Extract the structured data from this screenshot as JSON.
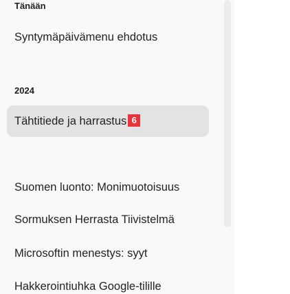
{
  "sidebar": {
    "sections": [
      {
        "heading": "Tänään",
        "items": [
          {
            "label": "Syntymäpäivämenu ehdotus"
          }
        ]
      },
      {
        "heading": "2024",
        "items": [
          {
            "label": "Tähtitiede ja harrastus",
            "badge": "6",
            "active": true
          },
          {
            "label": "Suomen luonto: Monimuotoisuus"
          },
          {
            "label": "Sormuksen Herrasta Tiivistelmä"
          },
          {
            "label": "Microsoftin menestys: syyt"
          },
          {
            "label": "Hakkerointiuhka Google-tilille"
          }
        ]
      }
    ]
  },
  "colors": {
    "sidebar_bg": "#f9f9f9",
    "active_item_bg": "#e3e3e3",
    "badge_bg": "#e8333a",
    "main_bg": "#ffffff"
  }
}
